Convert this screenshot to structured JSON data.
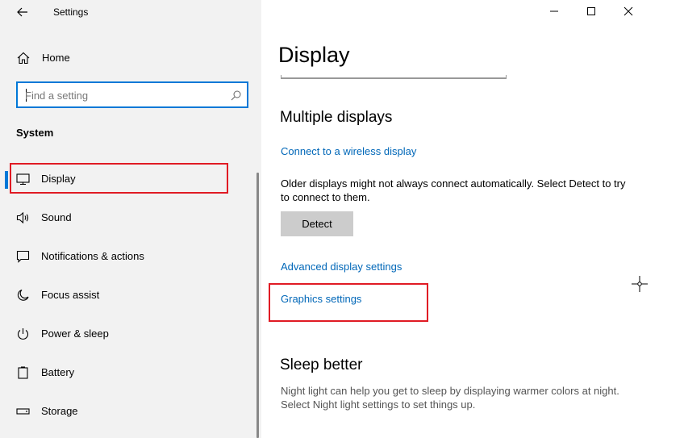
{
  "window": {
    "title": "Settings",
    "controls": [
      "minimize",
      "maximize",
      "close"
    ]
  },
  "sidebar": {
    "home_label": "Home",
    "search": {
      "placeholder": "Find a setting",
      "value": ""
    },
    "section": "System",
    "items": [
      {
        "label": "Display",
        "icon": "monitor-icon",
        "active": true
      },
      {
        "label": "Sound",
        "icon": "speaker-icon",
        "active": false
      },
      {
        "label": "Notifications & actions",
        "icon": "notification-icon",
        "active": false
      },
      {
        "label": "Focus assist",
        "icon": "moon-icon",
        "active": false
      },
      {
        "label": "Power & sleep",
        "icon": "power-icon",
        "active": false
      },
      {
        "label": "Battery",
        "icon": "battery-icon",
        "active": false
      },
      {
        "label": "Storage",
        "icon": "storage-icon",
        "active": false
      }
    ]
  },
  "main": {
    "title": "Display",
    "multiple_displays": {
      "heading": "Multiple displays",
      "wireless_link": "Connect to a wireless display",
      "description": "Older displays might not always connect automatically. Select Detect to try to connect to them.",
      "detect_button": "Detect",
      "advanced_link": "Advanced display settings",
      "graphics_link": "Graphics settings"
    },
    "sleep_better": {
      "heading": "Sleep better",
      "description": "Night light can help you get to sleep by displaying warmer colors at night. Select Night light settings to set things up."
    }
  },
  "colors": {
    "accent": "#0078d7",
    "link": "#0067b8",
    "highlight": "#e01b24",
    "sidebar_bg": "#f2f2f2"
  }
}
